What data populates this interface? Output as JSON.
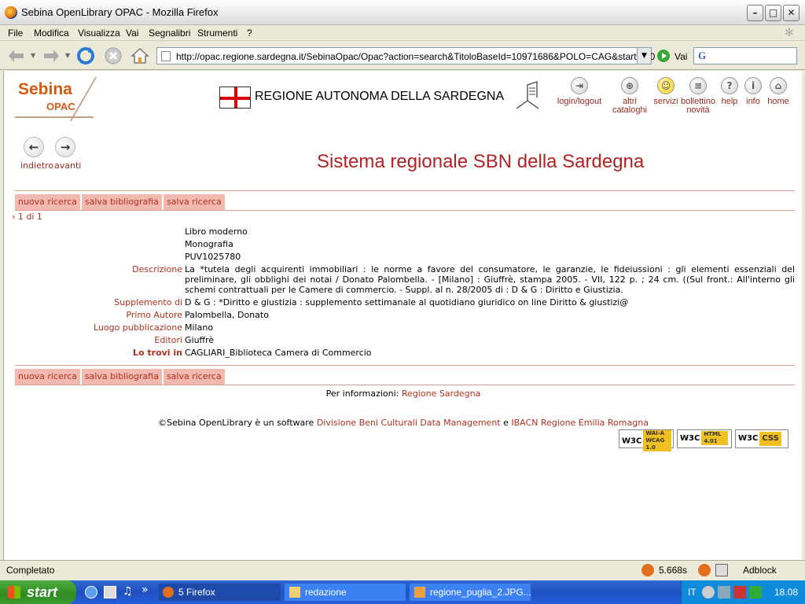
{
  "window": {
    "title": "Sebina OpenLibrary OPAC - Mozilla Firefox"
  },
  "menu": [
    "File",
    "Modifica",
    "Visualizza",
    "Vai",
    "Segnalibri",
    "Strumenti",
    "?"
  ],
  "navbar": {
    "url": "http://opac.regione.sardegna.it/SebinaOpac/Opac?action=search&TitoloBaseId=10971686&POLO=CAG&startat=0",
    "go_label": "Vai"
  },
  "page": {
    "logo_main": "Sebina",
    "logo_sub": "OPAC",
    "region": "REGIONE AUTONOMA DELLA SARDEGNA",
    "top_links": [
      {
        "label": "login/logout",
        "icon": "login-icon"
      },
      {
        "label": "altri\ncataloghi",
        "icon": "globe-icon"
      },
      {
        "label": "servizi",
        "icon": "smiley-icon"
      },
      {
        "label": "bollettino\nnovità",
        "icon": "news-icon"
      },
      {
        "label": "help",
        "icon": "help-icon"
      },
      {
        "label": "info",
        "icon": "info-icon"
      },
      {
        "label": "home",
        "icon": "home-icon"
      }
    ],
    "back_label": "indietro",
    "forward_label": "avanti",
    "heading": "Sistema regionale SBN della Sardegna",
    "buttons": [
      "nuova ricerca",
      "salva bibliografia",
      "salva ricerca"
    ],
    "pager": "1 di 1",
    "record": {
      "type1": "Libro moderno",
      "type2": "Monografia",
      "id": "PUV1025780",
      "fields": [
        {
          "label": "Descrizione",
          "value": "La *tutela degli acquirenti immobiliari : le norme a favore del consumatore, le garanzie, le fideiussioni : gli elementi essenziali del preliminare, gli obblighi dei notai / Donato Palombella. - [Milano] : Giuffrè, stampa 2005. - VII, 122 p. ; 24 cm. ((Sul front.: All'interno gli schemi contrattuali per le Camere di commercio. - Suppl. al n. 28/2005 di : D & G : Diritto e Giustizia."
        },
        {
          "label": "Supplemento di",
          "value": "D & G : *Diritto e giustizia : supplemento settimanale al quotidiano giuridico on line Diritto & giustizi@"
        },
        {
          "label": "Primo Autore",
          "value": "Palombella, Donato"
        },
        {
          "label": "Luogo pubblicazione",
          "value": "Milano"
        },
        {
          "label": "Editori",
          "value": "Giuffrè"
        }
      ],
      "location_label": "Lo trovi in",
      "location_value": "CAGLIARI_Biblioteca Camera di Commercio"
    },
    "info_prefix": "Per informazioni:",
    "info_link": "Regione Sardegna",
    "copyright_prefix": "©Sebina OpenLibrary è un software",
    "copyright_link1": "Divisione Beni Culturali Data Management",
    "copyright_mid": "e",
    "copyright_link2": "IBACN Regione Emilia Romagna",
    "badges": [
      {
        "w3c": "W3C",
        "text": "WAI-A WCAG 1.0"
      },
      {
        "w3c": "W3C",
        "text": "HTML 4.01"
      },
      {
        "w3c": "W3C",
        "text": "CSS"
      }
    ]
  },
  "status": {
    "text": "Completato",
    "time": "5.668s",
    "adblock": "Adblock"
  },
  "taskbar": {
    "start": "start",
    "tasks": [
      "5 Firefox",
      "redazione",
      "regione_puglia_2.JPG..."
    ],
    "lang": "IT",
    "clock": "18.08"
  }
}
